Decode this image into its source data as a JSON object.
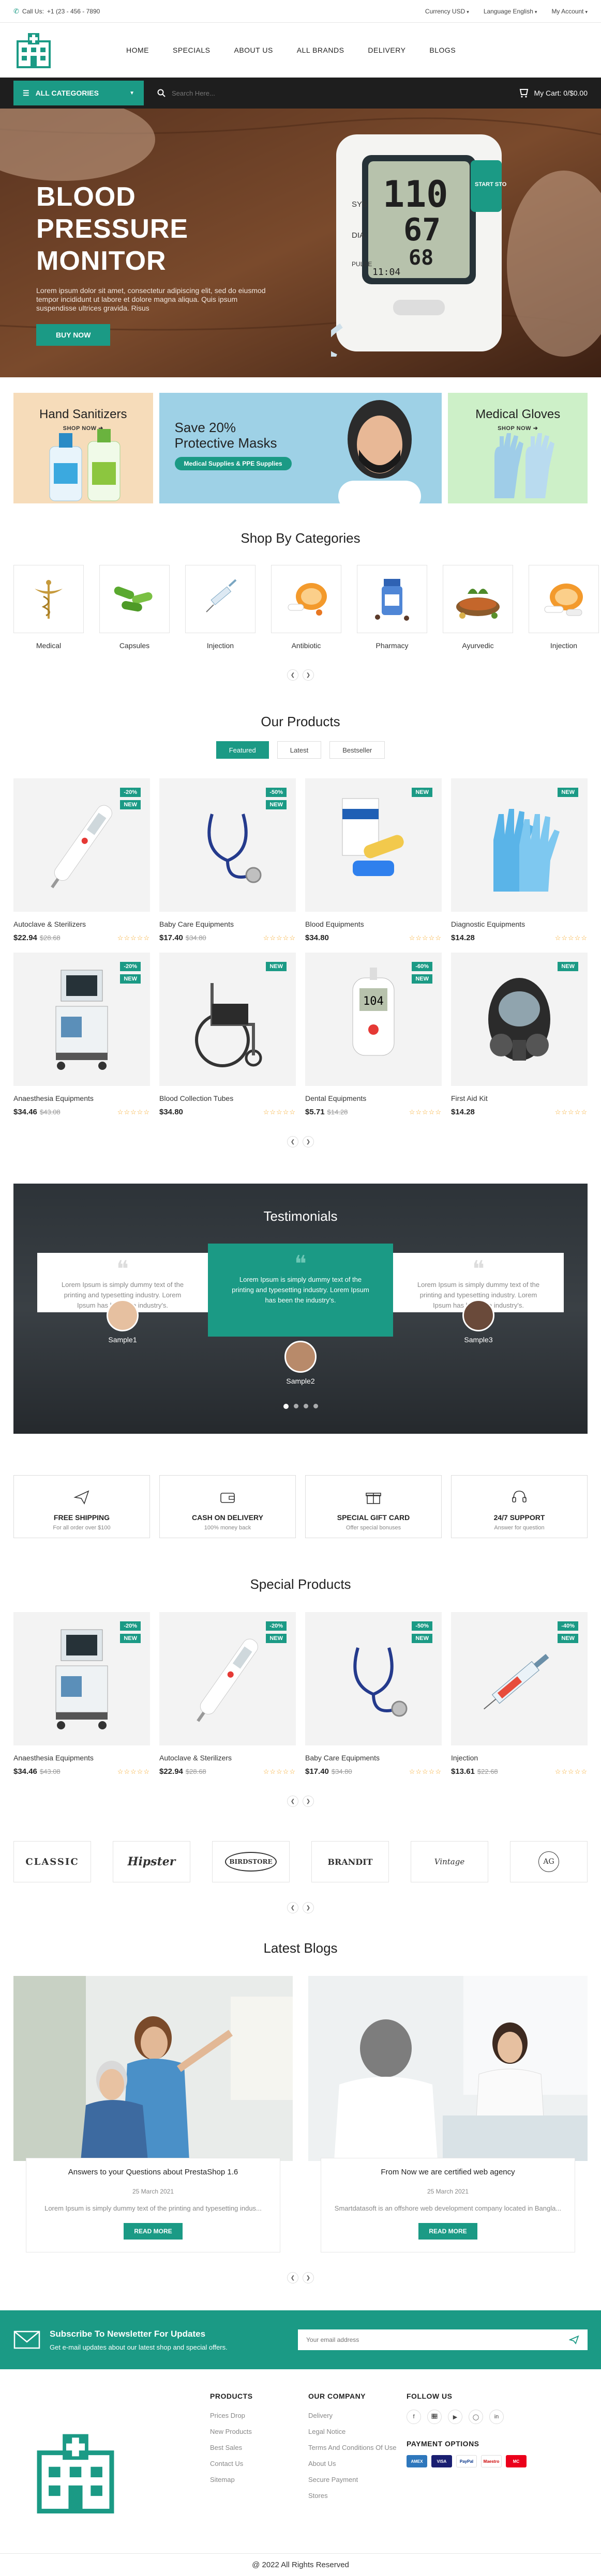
{
  "topbar": {
    "call_label": "Call Us:",
    "phone": "+1 (23 - 456 - 7890",
    "currency": "Currency USD",
    "language": "Language English",
    "account": "My Account"
  },
  "nav": [
    "HOME",
    "SPECIALS",
    "ABOUT US",
    "ALL BRANDS",
    "DELIVERY",
    "BLOGS"
  ],
  "catbar": {
    "all_categories": "ALL CATEGORIES",
    "search_placeholder": "Search Here...",
    "cart": "My Cart: 0/$0.00"
  },
  "hero": {
    "title_line1": "BLOOD PRESSURE",
    "title_line2": "MONITOR",
    "text": "Lorem ipsum dolor sit amet, consectetur adipiscing elit, sed do eiusmod tempor incididunt ut labore et dolore magna aliqua. Quis ipsum suspendisse ultrices gravida. Risus",
    "button": "BUY NOW",
    "display_top": "110",
    "display_mid": "67",
    "display_bot": "68",
    "display_time": "11:04",
    "sys": "SYS",
    "dia": "DIA",
    "pulse": "PULSE",
    "start": "START STOP"
  },
  "banners": {
    "b1_title": "Hand Sanitizers",
    "b1_link": "SHOP NOW",
    "b2_title_1": "Save 20%",
    "b2_title_2": "Protective Masks",
    "b2_pill": "Medical Supplies & PPE Supplies",
    "b3_title": "Medical Gloves",
    "b3_link": "SHOP NOW"
  },
  "categories": {
    "title": "Shop By Categories",
    "items": [
      "Medical",
      "Capsules",
      "Injection",
      "Antibiotic",
      "Pharmacy",
      "Ayurvedic",
      "Injection"
    ]
  },
  "products": {
    "title": "Our Products",
    "tabs": [
      "Featured",
      "Latest",
      "Bestseller"
    ],
    "items": [
      {
        "name": "Autoclave & Sterilizers",
        "price": "$22.94",
        "old": "$28.68",
        "disc": "-20%",
        "new": "NEW"
      },
      {
        "name": "Baby Care Equipments",
        "price": "$17.40",
        "old": "$34.80",
        "disc": "-50%",
        "new": "NEW"
      },
      {
        "name": "Blood Equipments",
        "price": "$34.80",
        "old": "",
        "disc": "",
        "new": "NEW"
      },
      {
        "name": "Diagnostic Equipments",
        "price": "$14.28",
        "old": "",
        "disc": "",
        "new": "NEW"
      },
      {
        "name": "Anaesthesia Equipments",
        "price": "$34.46",
        "old": "$43.08",
        "disc": "-20%",
        "new": "NEW"
      },
      {
        "name": "Blood Collection Tubes",
        "price": "$34.80",
        "old": "",
        "disc": "",
        "new": "NEW"
      },
      {
        "name": "Dental Equipments",
        "price": "$5.71",
        "old": "$14.28",
        "disc": "-60%",
        "new": "NEW"
      },
      {
        "name": "First Aid Kit",
        "price": "$14.28",
        "old": "",
        "disc": "",
        "new": "NEW"
      }
    ]
  },
  "testimonials": {
    "title": "Testimonials",
    "text": "Lorem Ipsum is simply dummy text of the printing and typesetting industry. Lorem Ipsum has been the industry's.",
    "names": [
      "Sample1",
      "Sample2",
      "Sample3"
    ]
  },
  "services": [
    {
      "title": "FREE SHIPPING",
      "sub": "For all order over $100"
    },
    {
      "title": "CASH ON DELIVERY",
      "sub": "100% money back"
    },
    {
      "title": "SPECIAL GIFT CARD",
      "sub": "Offer special bonuses"
    },
    {
      "title": "24/7 SUPPORT",
      "sub": "Answer for question"
    }
  ],
  "special": {
    "title": "Special Products",
    "items": [
      {
        "name": "Anaesthesia Equipments",
        "price": "$34.46",
        "old": "$43.08",
        "disc": "-20%",
        "new": "NEW"
      },
      {
        "name": "Autoclave & Sterilizers",
        "price": "$22.94",
        "old": "$28.68",
        "disc": "-20%",
        "new": "NEW"
      },
      {
        "name": "Baby Care Equipments",
        "price": "$17.40",
        "old": "$34.80",
        "disc": "-50%",
        "new": "NEW"
      },
      {
        "name": "Injection",
        "price": "$13.61",
        "old": "$22.68",
        "disc": "-40%",
        "new": "NEW"
      }
    ]
  },
  "brands": [
    "CLASSIC",
    "Hipster",
    "BIRDSTORE",
    "BRANDIT",
    "Vintage",
    "AG"
  ],
  "blogs": {
    "title": "Latest Blogs",
    "items": [
      {
        "title": "Answers to your Questions about PrestaShop 1.6",
        "date": "25 March 2021",
        "desc": "Lorem Ipsum is simply dummy text of the printing and typesetting indus...",
        "button": "READ MORE"
      },
      {
        "title": "From Now we are certified web agency",
        "date": "25 March 2021",
        "desc": "Smartdatasoft is an offshore web development company located in Bangla...",
        "button": "READ MORE"
      }
    ]
  },
  "newsletter": {
    "title": "Subscribe To Newsletter For Updates",
    "sub": "Get e-mail updates about our latest shop and special offers.",
    "placeholder": "Your email address"
  },
  "footer": {
    "products_title": "PRODUCTS",
    "products": [
      "Prices Drop",
      "New Products",
      "Best Sales",
      "Contact Us",
      "Sitemap"
    ],
    "company_title": "OUR COMPANY",
    "company": [
      "Delivery",
      "Legal Notice",
      "Terms And Conditions Of Use",
      "About Us",
      "Secure Payment",
      "Stores"
    ],
    "follow_title": "FOLLOW US",
    "social": [
      "f",
      "t",
      "yt",
      "ig",
      "in"
    ],
    "payment_title": "PAYMENT OPTIONS",
    "payments": [
      "AMEX",
      "VISA",
      "PayPal",
      "Maestro",
      "MC"
    ],
    "copyright": "@ 2022 All Rights Reserved"
  },
  "colors": {
    "accent": "#1b9a85",
    "dark": "#1e1e1e"
  }
}
